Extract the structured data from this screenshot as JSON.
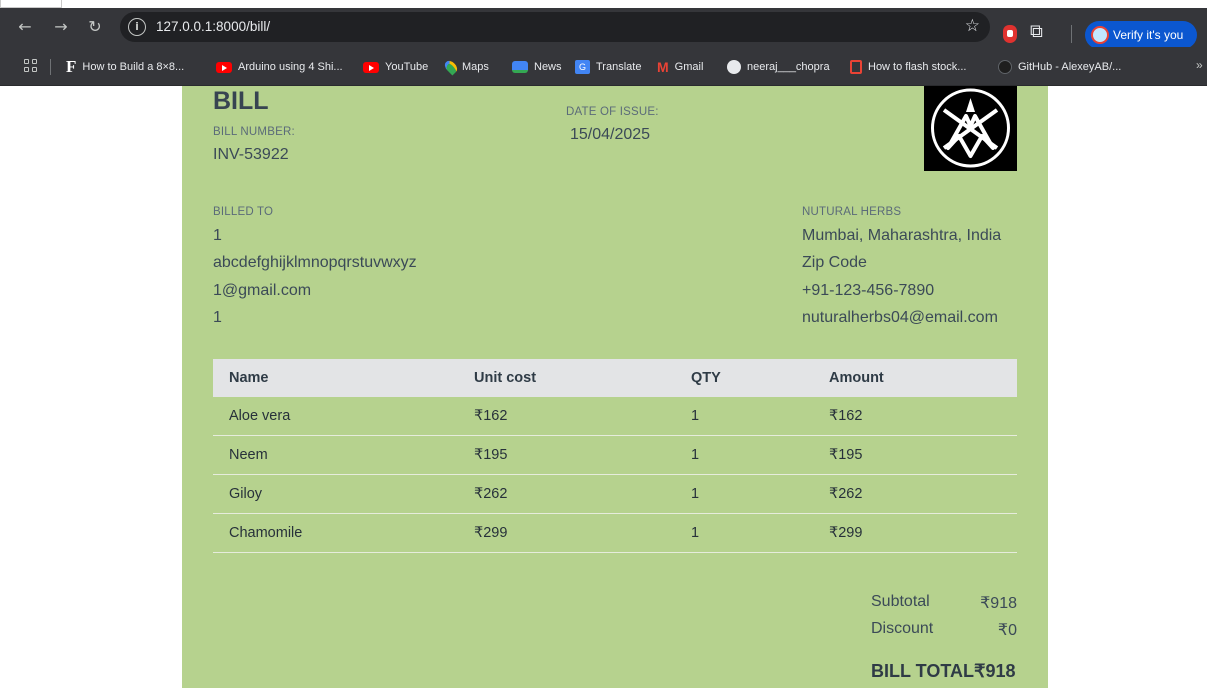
{
  "browser": {
    "url": "127.0.0.1:8000/bill/",
    "profile_button": "Verify it's you",
    "bookmarks": [
      {
        "label": "How to Build a 8×8...",
        "icon": "f-icon"
      },
      {
        "label": "Arduino using 4 Shi...",
        "icon": "youtube-icon"
      },
      {
        "label": "YouTube",
        "icon": "youtube-icon"
      },
      {
        "label": "Maps",
        "icon": "maps-icon"
      },
      {
        "label": "News",
        "icon": "news-icon"
      },
      {
        "label": "Translate",
        "icon": "translate-icon"
      },
      {
        "label": "Gmail",
        "icon": "gmail-icon"
      },
      {
        "label": "neeraj___chopra",
        "icon": "globe-icon"
      },
      {
        "label": "How to flash stock...",
        "icon": "bookmark-icon"
      },
      {
        "label": "GitHub - AlexeyAB/...",
        "icon": "github-icon"
      }
    ],
    "translate_icon_text": "G"
  },
  "bill": {
    "title": "BILL",
    "bill_number_label": "BILL NUMBER:",
    "bill_number": "INV-53922",
    "date_label": "DATE OF ISSUE:",
    "date": "15/04/2025",
    "billed_to_label": "BILLED TO",
    "billed_to": [
      "1",
      "abcdefghijklmnopqrstuvwxyz",
      "1@gmail.com",
      "1"
    ],
    "company_label": "NUTURAL HERBS",
    "company_lines": [
      "Mumbai, Maharashtra, India",
      "Zip Code",
      "+91-123-456-7890",
      "nuturalherbs04@email.com"
    ],
    "columns": [
      "Name",
      "Unit cost",
      "QTY",
      "Amount"
    ],
    "items": [
      {
        "name": "Aloe vera",
        "unit_cost": "₹162",
        "qty": "1",
        "amount": "₹162"
      },
      {
        "name": "Neem",
        "unit_cost": "₹195",
        "qty": "1",
        "amount": "₹195"
      },
      {
        "name": "Giloy",
        "unit_cost": "₹262",
        "qty": "1",
        "amount": "₹262"
      },
      {
        "name": "Chamomile",
        "unit_cost": "₹299",
        "qty": "1",
        "amount": "₹299"
      }
    ],
    "subtotal_label": "Subtotal",
    "subtotal": "₹918",
    "discount_label": "Discount",
    "discount": "₹0",
    "total_label": "BILL TOTAL",
    "total": "₹918"
  },
  "colors": {
    "bill_background": "#b6d28e",
    "table_header": "#e3e4e6",
    "browser_toolbar": "#35363a",
    "accent": "#0b57d0"
  }
}
